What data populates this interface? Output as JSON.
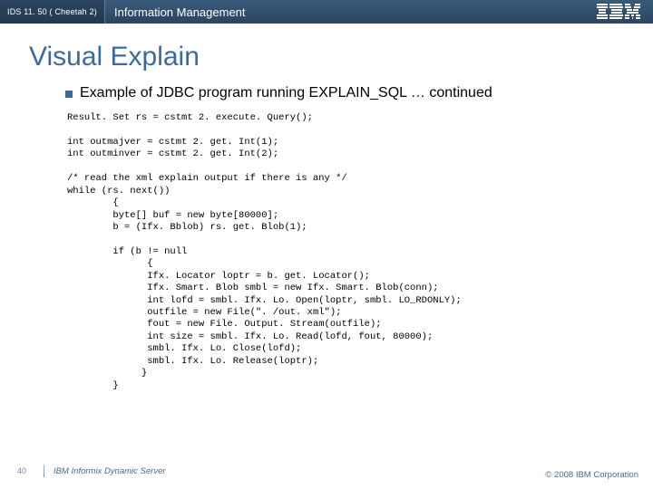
{
  "header": {
    "product": "IDS 11. 50 ( Cheetah 2)",
    "group": "Information Management",
    "logo_alt": "IBM"
  },
  "title": "Visual Explain",
  "bullet": "Example of JDBC program running EXPLAIN_SQL  … continued",
  "code": "Result. Set rs = cstmt 2. execute. Query();\n\nint outmajver = cstmt 2. get. Int(1);\nint outminver = cstmt 2. get. Int(2);\n\n/* read the xml explain output if there is any */\nwhile (rs. next())\n        {\n        byte[] buf = new byte[80000];\n        b = (Ifx. Bblob) rs. get. Blob(1);\n\n        if (b != null\n              {\n              Ifx. Locator loptr = b. get. Locator();\n              Ifx. Smart. Blob smbl = new Ifx. Smart. Blob(conn);\n              int lofd = smbl. Ifx. Lo. Open(loptr, smbl. LO_RDONLY);\n              outfile = new File(\". /out. xml\");\n              fout = new File. Output. Stream(outfile);\n              int size = smbl. Ifx. Lo. Read(lofd, fout, 80000);\n              smbl. Ifx. Lo. Close(lofd);\n              smbl. Ifx. Lo. Release(loptr);\n             }\n        }",
  "footer": {
    "page": "40",
    "product_line": "IBM Informix Dynamic Server",
    "copyright": "© 2008 IBM Corporation"
  }
}
